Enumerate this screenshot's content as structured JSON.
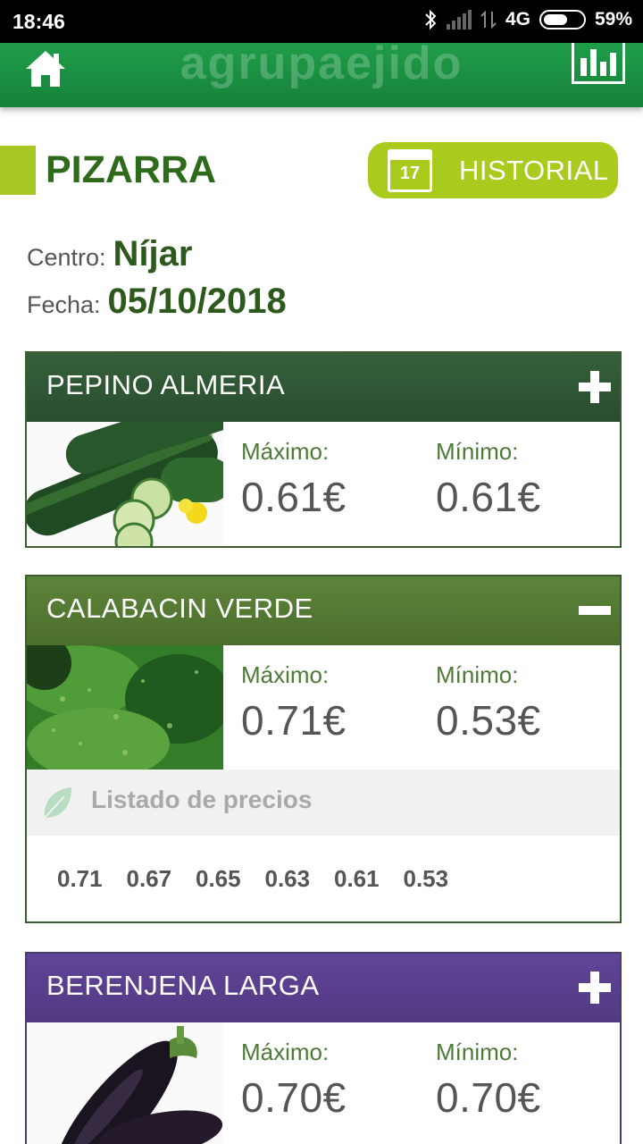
{
  "status_bar": {
    "time": "18:46",
    "network": "4G",
    "battery": "59%",
    "battery_level": 0.59
  },
  "header": {
    "logo_text": "agrupaejido",
    "icons": [
      "home-icon",
      "bar-chart-icon"
    ]
  },
  "page": {
    "title": "PIZARRA",
    "history_button": "HISTORIAL",
    "calendar_day": "17"
  },
  "info": {
    "centro_label": "Centro:",
    "centro_value": "Níjar",
    "fecha_label": "Fecha:",
    "fecha_value": "05/10/2018"
  },
  "colors": {
    "header_green": "#1c9444",
    "accent_lime": "#a8cb1d",
    "card_green_dark": "#2d5a32",
    "card_green_olive": "#557a33",
    "card_purple": "#5b3f8c"
  },
  "products": [
    {
      "name": "PEPINO ALMERIA",
      "expanded": false,
      "max_label": "Máximo:",
      "max_value": "0.61€",
      "min_label": "Mínimo:",
      "min_value": "0.61€"
    },
    {
      "name": "CALABACIN VERDE",
      "expanded": true,
      "max_label": "Máximo:",
      "max_value": "0.71€",
      "min_label": "Mínimo:",
      "min_value": "0.53€",
      "list_title": "Listado de precios",
      "prices": [
        "0.71",
        "0.67",
        "0.65",
        "0.63",
        "0.61",
        "0.53"
      ]
    },
    {
      "name": "BERENJENA LARGA",
      "expanded": false,
      "max_label": "Máximo:",
      "max_value": "0.70€",
      "min_label": "Mínimo:",
      "min_value": "0.70€"
    }
  ]
}
